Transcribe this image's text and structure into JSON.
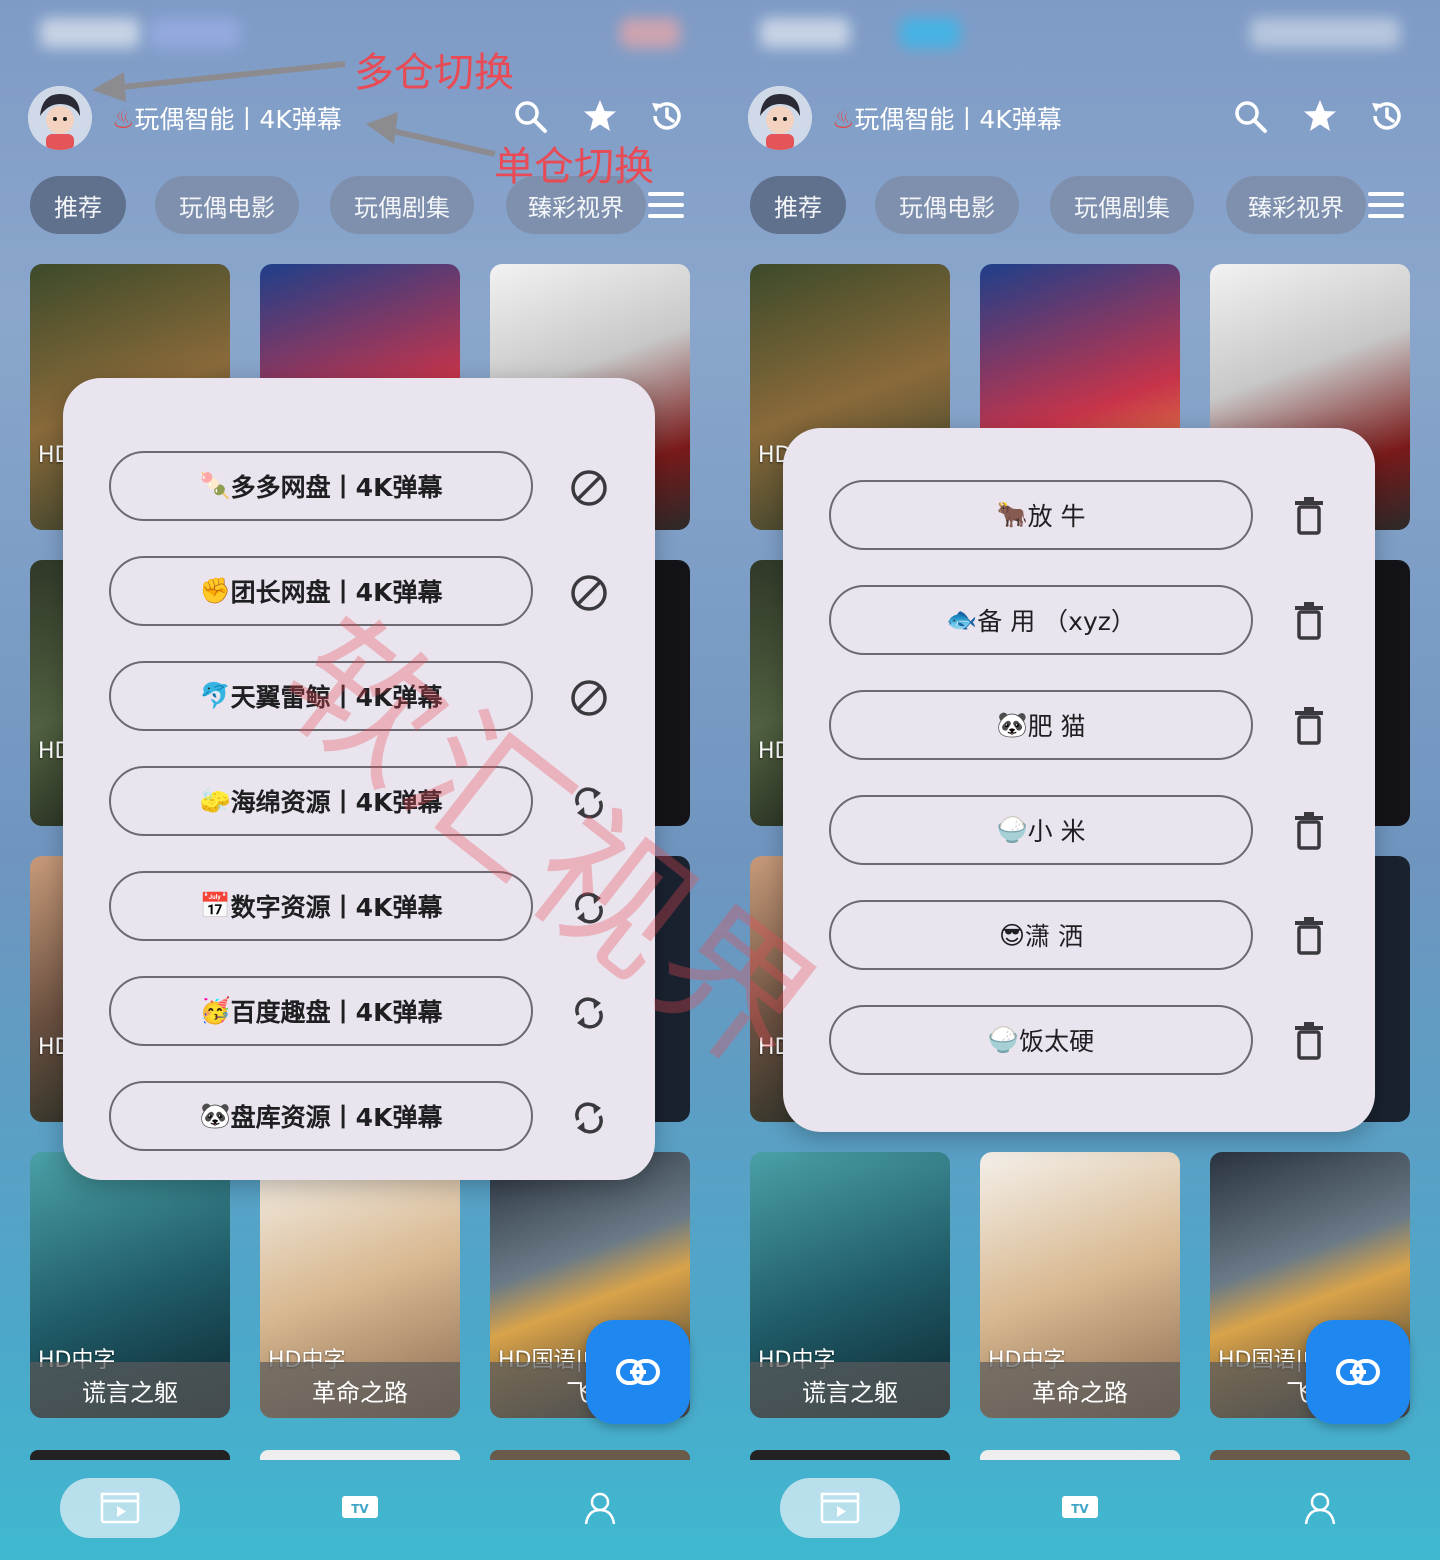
{
  "status": {
    "accent_blur": "#3fb6e8"
  },
  "header": {
    "source_icon": "♨",
    "source_name": "玩偶智能丨4K弹幕"
  },
  "tabs": [
    "推荐",
    "玩偶电影",
    "玩偶剧集",
    "臻彩视界"
  ],
  "posters_row4": [
    {
      "badge": "HD中字",
      "title": "谎言之躯"
    },
    {
      "badge": "HD中字",
      "title": "革命之路"
    },
    {
      "badge": "HD国语|中",
      "title": "飞行"
    }
  ],
  "partial_badges": [
    "HD",
    "HD",
    "HD"
  ],
  "nav": {
    "tv_label": "TV"
  },
  "left": {
    "dialog_items": [
      {
        "emoji": "🍡",
        "name": "多多网盘丨4K弹幕",
        "action": "ban-icon"
      },
      {
        "emoji": "✊",
        "name": "团长网盘丨4K弹幕",
        "action": "ban-icon"
      },
      {
        "emoji": "🐬",
        "name": "天翼雷鲸丨4K弹幕",
        "action": "ban-icon"
      },
      {
        "emoji": "🧽",
        "name": "海绵资源丨4K弹幕",
        "action": "refresh-icon"
      },
      {
        "emoji": "📅",
        "name": "数字资源丨4K弹幕",
        "action": "refresh-icon"
      },
      {
        "emoji": "🥳",
        "name": "百度趣盘丨4K弹幕",
        "action": "refresh-icon"
      },
      {
        "emoji": "🐼",
        "name": "盘库资源丨4K弹幕",
        "action": "refresh-icon"
      }
    ]
  },
  "right": {
    "dialog_items": [
      {
        "emoji": "🐂",
        "name": "放 牛",
        "action": "trash-icon"
      },
      {
        "emoji": "🐟",
        "name": "备 用 （xyz）",
        "action": "trash-icon"
      },
      {
        "emoji": "🐼",
        "name": "肥 猫",
        "action": "trash-icon"
      },
      {
        "emoji": "🍚",
        "name": "小 米",
        "action": "trash-icon"
      },
      {
        "emoji": "😎",
        "name": "潇 洒",
        "action": "trash-icon"
      },
      {
        "emoji": "🍚",
        "name": "饭太硬",
        "action": "trash-icon"
      }
    ]
  },
  "annotations": {
    "multi_repo": "多仓切换",
    "single_repo": "单仓切换",
    "watermark": "软汇视界",
    "color": "#e84b55"
  },
  "colors": {
    "fab": "#1e88f0",
    "dialog_bg": "#e9e4ee",
    "flame": "#e8453c"
  }
}
